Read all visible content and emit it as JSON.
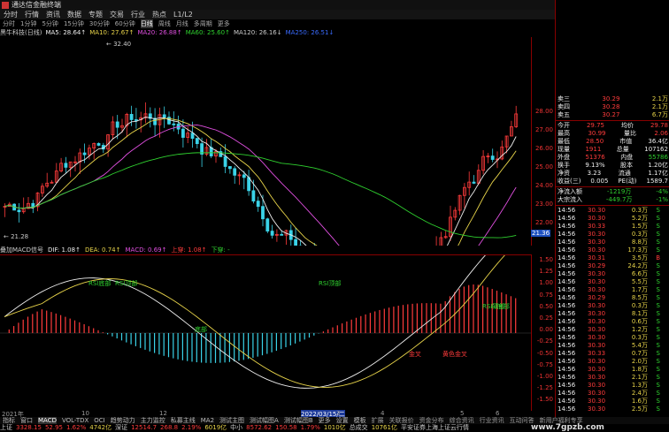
{
  "titlebar": {
    "app_title": "通达信金融终端",
    "account_label": "交易"
  },
  "menu": [
    "分时",
    "行情",
    "资讯",
    "数据",
    "专题",
    "交易",
    "行业",
    "热点",
    "L1/L2"
  ],
  "periods": [
    {
      "label": "分时",
      "selected": false
    },
    {
      "label": "1分钟",
      "selected": false
    },
    {
      "label": "5分钟",
      "selected": false
    },
    {
      "label": "15分钟",
      "selected": false
    },
    {
      "label": "30分钟",
      "selected": false
    },
    {
      "label": "60分钟",
      "selected": false
    },
    {
      "label": "日线",
      "selected": true
    },
    {
      "label": "周线",
      "selected": false
    },
    {
      "label": "月线",
      "selected": false
    },
    {
      "label": "多周期",
      "selected": false
    },
    {
      "label": "更多",
      "selected": false
    }
  ],
  "ma_legend": [
    {
      "text": "黑牛科技(日线)",
      "color": "#cccccc"
    },
    {
      "text": "MA5: 28.64↑",
      "color": "#eeeeee"
    },
    {
      "text": "MA10: 27.67↑",
      "color": "#e8d44a"
    },
    {
      "text": "MA20: 26.88↑",
      "color": "#e04fe0"
    },
    {
      "text": "MA60: 25.60↑",
      "color": "#2fd12f"
    },
    {
      "text": "MA120: 26.16↓",
      "color": "#cccccc"
    },
    {
      "text": "MA250: 26.51↓",
      "color": "#3a6bff"
    }
  ],
  "price_axis": {
    "ticks": [
      "28.00",
      "27.00",
      "26.00",
      "25.00",
      "24.00",
      "23.00",
      "22.00"
    ],
    "current": "21.36"
  },
  "annotations": {
    "high": "32.40",
    "low": "21.28"
  },
  "macd_legend": [
    {
      "text": "叠加MACD信号",
      "color": "#cccccc"
    },
    {
      "text": "DIF: 1.08↑",
      "color": "#eeeeee"
    },
    {
      "text": "DEA: 0.74↑",
      "color": "#e8d44a"
    },
    {
      "text": "MACD: 0.69↑",
      "color": "#e04fe0"
    },
    {
      "text": "上穿: 1.08↑",
      "color": "#ff3b3b"
    },
    {
      "text": "下穿: -",
      "color": "#2fd12f"
    }
  ],
  "macd_axis": [
    "1.50",
    "1.25",
    "1.00",
    "0.75",
    "0.50",
    "0.25",
    "0.00",
    "-0.25",
    "-0.50",
    "-0.75",
    "-1.00",
    "-1.25",
    "-1.50"
  ],
  "macd_labels": [
    "RSI底部",
    "RSI顶部",
    "RSI顶部",
    "底部",
    "金叉",
    "RSI顶部",
    "AI底部",
    "黄色金叉"
  ],
  "date_axis": [
    "2021年",
    "10",
    "12",
    "2022/03/15/二",
    "3",
    "4",
    "5",
    "6"
  ],
  "toolbar": [
    {
      "label": "指标",
      "active": false
    },
    {
      "label": "窗口",
      "active": false
    },
    {
      "label": "MACD",
      "active": true
    },
    {
      "label": "VOL-TDX",
      "active": false
    },
    {
      "label": "OCI",
      "active": false
    },
    {
      "label": "趋势动力",
      "active": false
    },
    {
      "label": "主力监控",
      "active": false
    },
    {
      "label": "私募主线",
      "active": false
    },
    {
      "label": "MA2",
      "active": false
    },
    {
      "label": "测试主图",
      "active": false
    },
    {
      "label": "测试幅图A",
      "active": false
    },
    {
      "label": "测试幅图B",
      "active": false
    },
    {
      "label": "更多",
      "active": false
    },
    {
      "label": "设置",
      "active": false
    },
    {
      "label": "模板",
      "active": false
    }
  ],
  "subtabs": [
    "扩展",
    "关联报价",
    "资金分布",
    "综合资讯",
    "行业资讯",
    "互动问答",
    "新用户福利专享"
  ],
  "statusbar": [
    {
      "text": "上证",
      "color": "#cccccc"
    },
    {
      "text": "3328.15",
      "color": "#ff3b3b"
    },
    {
      "text": "52.95",
      "color": "#ff3b3b"
    },
    {
      "text": "1.62%",
      "color": "#ff3b3b"
    },
    {
      "text": "4742亿",
      "color": "#e8d44a"
    },
    {
      "text": "深证",
      "color": "#cccccc"
    },
    {
      "text": "12514.7",
      "color": "#ff3b3b"
    },
    {
      "text": "268.8",
      "color": "#ff3b3b"
    },
    {
      "text": "2.19%",
      "color": "#ff3b3b"
    },
    {
      "text": "6019亿",
      "color": "#e8d44a"
    },
    {
      "text": "中小",
      "color": "#cccccc"
    },
    {
      "text": "8572.62",
      "color": "#ff3b3b"
    },
    {
      "text": "150.58",
      "color": "#ff3b3b"
    },
    {
      "text": "1.79%",
      "color": "#ff3b3b"
    },
    {
      "text": "1010亿",
      "color": "#e8d44a"
    },
    {
      "text": "总成交",
      "color": "#cccccc"
    },
    {
      "text": "10761亿",
      "color": "#e8d44a"
    },
    {
      "text": "平安证券上海上证云行情",
      "color": "#cccccc"
    }
  ],
  "quote_panel": {
    "asks": [
      {
        "label": "卖三",
        "price": "30.29",
        "vol": "2.1万"
      },
      {
        "label": "卖四",
        "price": "30.28",
        "vol": "2.1万"
      },
      {
        "label": "卖五",
        "price": "30.27",
        "vol": "6.7万"
      }
    ],
    "stats": [
      {
        "l1": "今开",
        "v1": "29.75",
        "l2": "均价",
        "v2": "29.78"
      },
      {
        "l1": "最高",
        "v1": "30.99",
        "l2": "量比",
        "v2": "2.06"
      },
      {
        "l1": "最低",
        "v1": "28.50",
        "l2": "市值",
        "v2": "36.4亿"
      },
      {
        "l1": "现量",
        "v1": "1911",
        "l2": "总量",
        "v2": "107162"
      },
      {
        "l1": "外盘",
        "v1": "51376",
        "l2": "内盘",
        "v2": "55786"
      },
      {
        "l1": "换手",
        "v1": "9.13%",
        "l2": "股本",
        "v2": "1.20亿"
      },
      {
        "l1": "净资",
        "v1": "3.23",
        "l2": "流通",
        "v2": "1.17亿"
      },
      {
        "l1": "收益(三)",
        "v1": "0.005",
        "l2": "PE(动)",
        "v2": "1589.7"
      }
    ],
    "flows": [
      {
        "label": "净流入额",
        "value": "-1219万",
        "pct": "-4%"
      },
      {
        "label": "大宗流入",
        "value": "-449.7万",
        "pct": "-1%"
      }
    ],
    "ticks": [
      [
        "14:56",
        "30.30",
        "0.3万",
        "S"
      ],
      [
        "14:56",
        "30.30",
        "5.2万",
        "S"
      ],
      [
        "14:56",
        "30.33",
        "1.5万",
        "S"
      ],
      [
        "14:56",
        "30.30",
        "0.3万",
        "S"
      ],
      [
        "14:56",
        "30.30",
        "8.8万",
        "S"
      ],
      [
        "14:56",
        "30.30",
        "17.3万",
        "S"
      ],
      [
        "14:56",
        "30.31",
        "3.5万",
        "B"
      ],
      [
        "14:56",
        "30.29",
        "24.2万",
        "S"
      ],
      [
        "14:56",
        "30.30",
        "6.6万",
        "S"
      ],
      [
        "14:56",
        "30.30",
        "5.5万",
        "S"
      ],
      [
        "14:56",
        "30.30",
        "1.7万",
        "S"
      ],
      [
        "14:56",
        "30.29",
        "8.5万",
        "S"
      ],
      [
        "14:56",
        "30.30",
        "0.3万",
        "S"
      ],
      [
        "14:56",
        "30.30",
        "8.1万",
        "S"
      ],
      [
        "14:56",
        "30.30",
        "0.6万",
        "S"
      ],
      [
        "14:56",
        "30.30",
        "1.2万",
        "S"
      ],
      [
        "14:56",
        "30.30",
        "0.3万",
        "S"
      ],
      [
        "14:56",
        "30.30",
        "5.4万",
        "S"
      ],
      [
        "14:56",
        "30.33",
        "0.7万",
        "S"
      ],
      [
        "14:56",
        "30.30",
        "2.0万",
        "S"
      ],
      [
        "14:56",
        "30.30",
        "1.8万",
        "S"
      ],
      [
        "14:56",
        "30.30",
        "2.1万",
        "S"
      ],
      [
        "14:56",
        "30.30",
        "1.3万",
        "S"
      ],
      [
        "14:56",
        "30.30",
        "2.4万",
        "S"
      ],
      [
        "14:56",
        "30.30",
        "1.6万",
        "S"
      ],
      [
        "14:56",
        "30.30",
        "2.5万",
        "S"
      ]
    ],
    "bottom": "图文F10 数据"
  },
  "watermark": "www.7gpzb.com"
}
